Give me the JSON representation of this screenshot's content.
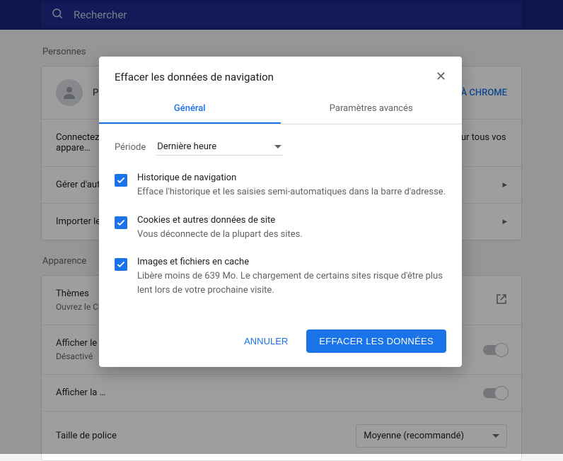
{
  "search": {
    "placeholder": "Rechercher"
  },
  "sections": {
    "people": {
      "title": "Personnes",
      "profileInitial": "P",
      "chromeLink": "À CHROME",
      "row1": "Connectez-… Synchronisez vos favoris, votre historique, vos mots de passe et d'autres paramètres sur tous vos appare…",
      "row2": "Gérer d'aut…",
      "row3": "Importer le…"
    },
    "appearance": {
      "title": "Apparence",
      "themes": {
        "label": "Thèmes",
        "sub": "Ouvrez le C…"
      },
      "homeBtn": {
        "label": "Afficher le …",
        "sub": "Désactivé"
      },
      "bookmarks": {
        "label": "Afficher la …"
      },
      "fontSize": {
        "label": "Taille de police",
        "value": "Moyenne (recommandé)"
      }
    }
  },
  "dialog": {
    "title": "Effacer les données de navigation",
    "tabs": {
      "basic": "Général",
      "advanced": "Paramètres avancés"
    },
    "period": {
      "label": "Période",
      "value": "Dernière heure"
    },
    "opts": [
      {
        "title": "Historique de navigation",
        "desc": "Efface l'historique et les saisies semi-automatiques dans la barre d'adresse."
      },
      {
        "title": "Cookies et autres données de site",
        "desc": "Vous déconnecte de la plupart des sites."
      },
      {
        "title": "Images et fichiers en cache",
        "desc": "Libère moins de 639 Mo. Le chargement de certains sites risque d'être plus lent lors de votre prochaine visite."
      }
    ],
    "cancel": "ANNULER",
    "confirm": "EFFACER LES DONNÉES"
  }
}
